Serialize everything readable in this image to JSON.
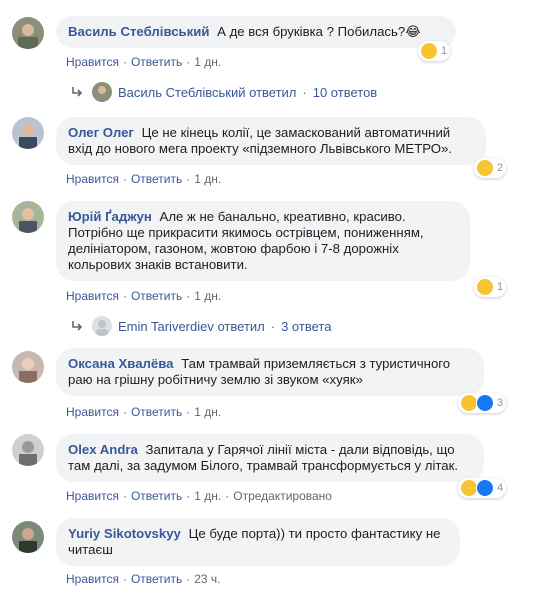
{
  "actions": {
    "like": "Нравится",
    "reply": "Ответить",
    "sep": "·"
  },
  "comments": [
    {
      "author": "Василь Стеблівський",
      "text": "А де вся бруківка ? Побилась?😂",
      "reactions": {
        "types": [
          "haha"
        ],
        "count": "1"
      },
      "time": "1 дн.",
      "replies": {
        "author": "Василь Стеблівський",
        "verb": "ответил",
        "count": "10 ответов"
      }
    },
    {
      "author": "Олег Олег",
      "text": "Це не кінець колії, це замаскований автоматичний вхід до нового мега проекту «підземного Львівського МЕТРО».",
      "reactions": {
        "types": [
          "haha"
        ],
        "count": "2"
      },
      "time": "1 дн."
    },
    {
      "author": "Юрій Ґаджун",
      "text": "Але ж не банально, креативно, красиво. Потрібно ще прикрасити якимось острівцем, пониженням, делініатором, газоном, жовтою фарбою і 7-8 дорожніх кольрових знаків встановити.",
      "reactions": {
        "types": [
          "haha"
        ],
        "count": "1"
      },
      "time": "1 дн.",
      "replies": {
        "author": "Emin Tariverdiev",
        "verb": "ответил",
        "count": "3 ответа"
      }
    },
    {
      "author": "Оксана Хвалёва",
      "text": "Там трамвай приземляється з туристичного раю на грішну робітничу землю зі звуком «хуяк»",
      "reactions": {
        "types": [
          "haha",
          "like"
        ],
        "count": "3"
      },
      "time": "1 дн."
    },
    {
      "author": "Olex Andra",
      "text": "Запитала у Гарячої лінії міста - дали відповідь, що там далі, за задумом Білого, трамвай трансформується у літак.",
      "reactions": {
        "types": [
          "haha",
          "like"
        ],
        "count": "4"
      },
      "time": "1 дн.",
      "edited": "Отредактировано"
    },
    {
      "author": "Yuriy Sikotovskyy",
      "text": "Це буде порта)) ти просто фантастику не читаєш",
      "time": "23 ч."
    }
  ]
}
